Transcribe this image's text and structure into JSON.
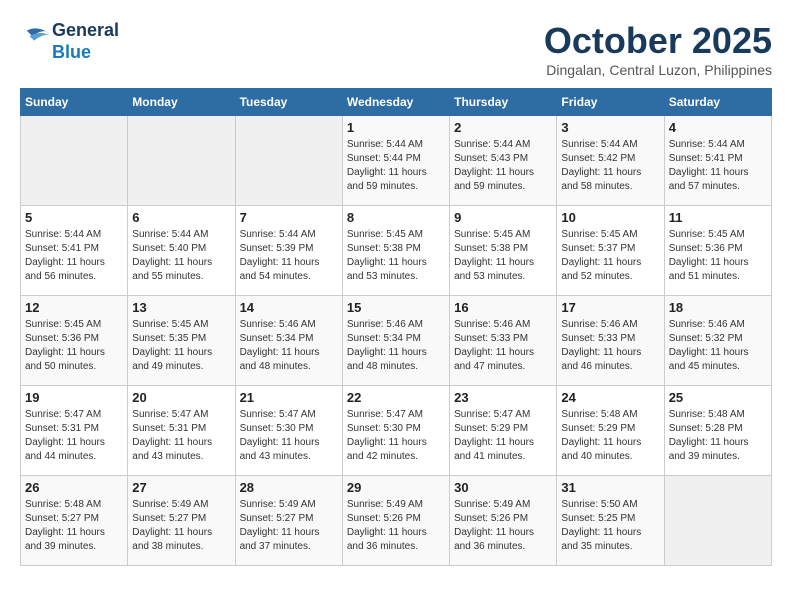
{
  "header": {
    "logo_line1": "General",
    "logo_line2": "Blue",
    "month": "October 2025",
    "location": "Dingalan, Central Luzon, Philippines"
  },
  "weekdays": [
    "Sunday",
    "Monday",
    "Tuesday",
    "Wednesday",
    "Thursday",
    "Friday",
    "Saturday"
  ],
  "weeks": [
    [
      {
        "day": "",
        "sunrise": "",
        "sunset": "",
        "daylight": ""
      },
      {
        "day": "",
        "sunrise": "",
        "sunset": "",
        "daylight": ""
      },
      {
        "day": "",
        "sunrise": "",
        "sunset": "",
        "daylight": ""
      },
      {
        "day": "1",
        "sunrise": "Sunrise: 5:44 AM",
        "sunset": "Sunset: 5:44 PM",
        "daylight": "Daylight: 11 hours and 59 minutes."
      },
      {
        "day": "2",
        "sunrise": "Sunrise: 5:44 AM",
        "sunset": "Sunset: 5:43 PM",
        "daylight": "Daylight: 11 hours and 59 minutes."
      },
      {
        "day": "3",
        "sunrise": "Sunrise: 5:44 AM",
        "sunset": "Sunset: 5:42 PM",
        "daylight": "Daylight: 11 hours and 58 minutes."
      },
      {
        "day": "4",
        "sunrise": "Sunrise: 5:44 AM",
        "sunset": "Sunset: 5:41 PM",
        "daylight": "Daylight: 11 hours and 57 minutes."
      }
    ],
    [
      {
        "day": "5",
        "sunrise": "Sunrise: 5:44 AM",
        "sunset": "Sunset: 5:41 PM",
        "daylight": "Daylight: 11 hours and 56 minutes."
      },
      {
        "day": "6",
        "sunrise": "Sunrise: 5:44 AM",
        "sunset": "Sunset: 5:40 PM",
        "daylight": "Daylight: 11 hours and 55 minutes."
      },
      {
        "day": "7",
        "sunrise": "Sunrise: 5:44 AM",
        "sunset": "Sunset: 5:39 PM",
        "daylight": "Daylight: 11 hours and 54 minutes."
      },
      {
        "day": "8",
        "sunrise": "Sunrise: 5:45 AM",
        "sunset": "Sunset: 5:38 PM",
        "daylight": "Daylight: 11 hours and 53 minutes."
      },
      {
        "day": "9",
        "sunrise": "Sunrise: 5:45 AM",
        "sunset": "Sunset: 5:38 PM",
        "daylight": "Daylight: 11 hours and 53 minutes."
      },
      {
        "day": "10",
        "sunrise": "Sunrise: 5:45 AM",
        "sunset": "Sunset: 5:37 PM",
        "daylight": "Daylight: 11 hours and 52 minutes."
      },
      {
        "day": "11",
        "sunrise": "Sunrise: 5:45 AM",
        "sunset": "Sunset: 5:36 PM",
        "daylight": "Daylight: 11 hours and 51 minutes."
      }
    ],
    [
      {
        "day": "12",
        "sunrise": "Sunrise: 5:45 AM",
        "sunset": "Sunset: 5:36 PM",
        "daylight": "Daylight: 11 hours and 50 minutes."
      },
      {
        "day": "13",
        "sunrise": "Sunrise: 5:45 AM",
        "sunset": "Sunset: 5:35 PM",
        "daylight": "Daylight: 11 hours and 49 minutes."
      },
      {
        "day": "14",
        "sunrise": "Sunrise: 5:46 AM",
        "sunset": "Sunset: 5:34 PM",
        "daylight": "Daylight: 11 hours and 48 minutes."
      },
      {
        "day": "15",
        "sunrise": "Sunrise: 5:46 AM",
        "sunset": "Sunset: 5:34 PM",
        "daylight": "Daylight: 11 hours and 48 minutes."
      },
      {
        "day": "16",
        "sunrise": "Sunrise: 5:46 AM",
        "sunset": "Sunset: 5:33 PM",
        "daylight": "Daylight: 11 hours and 47 minutes."
      },
      {
        "day": "17",
        "sunrise": "Sunrise: 5:46 AM",
        "sunset": "Sunset: 5:33 PM",
        "daylight": "Daylight: 11 hours and 46 minutes."
      },
      {
        "day": "18",
        "sunrise": "Sunrise: 5:46 AM",
        "sunset": "Sunset: 5:32 PM",
        "daylight": "Daylight: 11 hours and 45 minutes."
      }
    ],
    [
      {
        "day": "19",
        "sunrise": "Sunrise: 5:47 AM",
        "sunset": "Sunset: 5:31 PM",
        "daylight": "Daylight: 11 hours and 44 minutes."
      },
      {
        "day": "20",
        "sunrise": "Sunrise: 5:47 AM",
        "sunset": "Sunset: 5:31 PM",
        "daylight": "Daylight: 11 hours and 43 minutes."
      },
      {
        "day": "21",
        "sunrise": "Sunrise: 5:47 AM",
        "sunset": "Sunset: 5:30 PM",
        "daylight": "Daylight: 11 hours and 43 minutes."
      },
      {
        "day": "22",
        "sunrise": "Sunrise: 5:47 AM",
        "sunset": "Sunset: 5:30 PM",
        "daylight": "Daylight: 11 hours and 42 minutes."
      },
      {
        "day": "23",
        "sunrise": "Sunrise: 5:47 AM",
        "sunset": "Sunset: 5:29 PM",
        "daylight": "Daylight: 11 hours and 41 minutes."
      },
      {
        "day": "24",
        "sunrise": "Sunrise: 5:48 AM",
        "sunset": "Sunset: 5:29 PM",
        "daylight": "Daylight: 11 hours and 40 minutes."
      },
      {
        "day": "25",
        "sunrise": "Sunrise: 5:48 AM",
        "sunset": "Sunset: 5:28 PM",
        "daylight": "Daylight: 11 hours and 39 minutes."
      }
    ],
    [
      {
        "day": "26",
        "sunrise": "Sunrise: 5:48 AM",
        "sunset": "Sunset: 5:27 PM",
        "daylight": "Daylight: 11 hours and 39 minutes."
      },
      {
        "day": "27",
        "sunrise": "Sunrise: 5:49 AM",
        "sunset": "Sunset: 5:27 PM",
        "daylight": "Daylight: 11 hours and 38 minutes."
      },
      {
        "day": "28",
        "sunrise": "Sunrise: 5:49 AM",
        "sunset": "Sunset: 5:27 PM",
        "daylight": "Daylight: 11 hours and 37 minutes."
      },
      {
        "day": "29",
        "sunrise": "Sunrise: 5:49 AM",
        "sunset": "Sunset: 5:26 PM",
        "daylight": "Daylight: 11 hours and 36 minutes."
      },
      {
        "day": "30",
        "sunrise": "Sunrise: 5:49 AM",
        "sunset": "Sunset: 5:26 PM",
        "daylight": "Daylight: 11 hours and 36 minutes."
      },
      {
        "day": "31",
        "sunrise": "Sunrise: 5:50 AM",
        "sunset": "Sunset: 5:25 PM",
        "daylight": "Daylight: 11 hours and 35 minutes."
      },
      {
        "day": "",
        "sunrise": "",
        "sunset": "",
        "daylight": ""
      }
    ]
  ]
}
